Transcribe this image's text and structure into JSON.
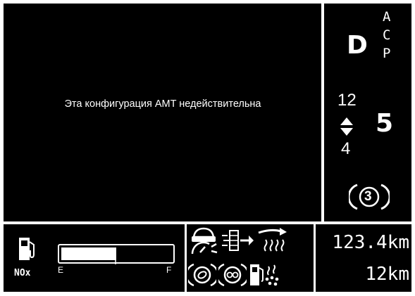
{
  "message": "Эта конфигурация AMT недействительна",
  "gear": {
    "mode": "D",
    "mode_options": [
      "A",
      "C",
      "P"
    ],
    "upper_gear": "12",
    "lower_gear": "4",
    "current_gear": "5",
    "badge_number": "3"
  },
  "fuel_gauge": {
    "label_empty": "E",
    "label_full": "F",
    "level_fraction": 0.5,
    "nox_label": "NOx"
  },
  "trip": {
    "odometer": "123.4km",
    "range": "12km"
  },
  "icons": [
    "fuel-pump-icon",
    "vehicle-speed-limit-icon",
    "dpf-regeneration-icon",
    "exhaust-heat-icon",
    "brake-system-icon",
    "tire-pressure-icon",
    "fuel-filter-icon"
  ],
  "colors": {
    "background": "#000000",
    "foreground": "#ffffff"
  }
}
